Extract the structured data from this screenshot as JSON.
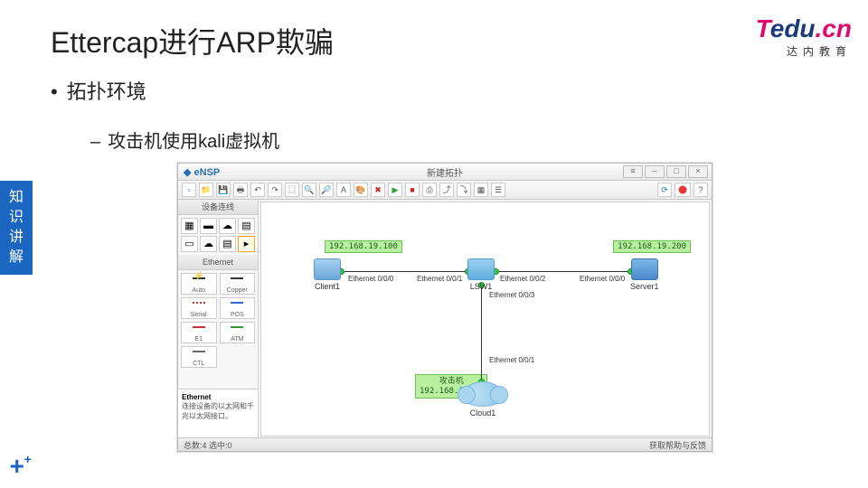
{
  "slide": {
    "title": "Ettercap进行ARP欺骗",
    "bullet1": "拓扑环境",
    "bullet2": "攻击机使用kali虚拟机"
  },
  "logo": {
    "t": "T",
    "edu": "edu",
    "cn": ".cn",
    "sub": "达内教育"
  },
  "tab": {
    "l1": "知",
    "l2": "识",
    "l3": "讲",
    "l4": "解"
  },
  "app": {
    "brand": "eNSP",
    "titlebar": "新建拓扑",
    "winbtns": {
      "menu": "≡",
      "min": "–",
      "max": "□",
      "close": "×"
    },
    "status_left": "总数:4 选中:0",
    "status_right": "获取帮助与反馈",
    "devices_header": "设备连线",
    "ethernet_header": "Ethernet",
    "info_title": "Ethernet",
    "info_desc": "连接设备的以太网和千兆以太网接口。",
    "device_icons": [
      "▦",
      "▬",
      "☁",
      "▤",
      "▭",
      "☁",
      "▤",
      "▸"
    ],
    "cables": [
      {
        "name": "Auto",
        "cls": "auto"
      },
      {
        "name": "Copper",
        "cls": "copper"
      },
      {
        "name": "Serial",
        "cls": "serial"
      },
      {
        "name": "POS",
        "cls": "pos"
      },
      {
        "name": "E1",
        "cls": "e1"
      },
      {
        "name": "ATM",
        "cls": "atm"
      },
      {
        "name": "CTL",
        "cls": "ctl"
      }
    ]
  },
  "topology": {
    "client": {
      "name": "Client1",
      "ip": "192.168.19.100"
    },
    "switch": {
      "name": "LSW1"
    },
    "server": {
      "name": "Server1",
      "ip": "192.168.19.200"
    },
    "cloud": {
      "name": "Cloud1",
      "label": "攻击机",
      "ip": "192.168.19.66"
    },
    "ports": {
      "p1": "Ethernet 0/0/0",
      "p2": "Ethernet 0/0/1",
      "p3": "Ethernet 0/0/2",
      "p4": "Ethernet 0/0/0",
      "p5": "Ethernet 0/0/3",
      "p6": "Ethernet 0/0/1"
    }
  }
}
